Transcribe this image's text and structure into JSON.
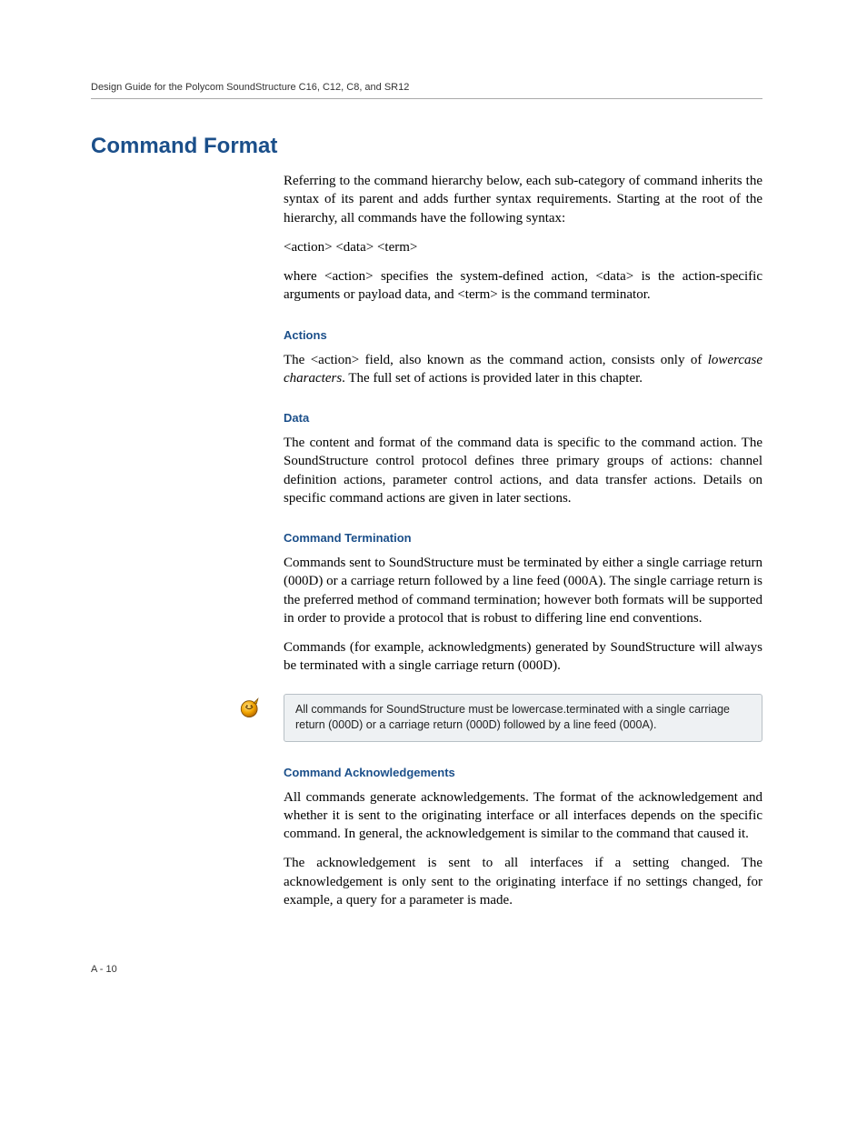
{
  "header": {
    "runningTitle": "Design Guide for the Polycom SoundStructure C16, C12, C8, and SR12"
  },
  "title": "Command Format",
  "intro": {
    "p1": "Referring to the command hierarchy below, each sub-category of command inherits the syntax of its parent and adds further syntax requirements. Starting at the root of the hierarchy, all commands have the following syntax:",
    "syntax": "<action> <data> <term>",
    "p2": "where <action> specifies the system-defined action, <data> is the action-specific arguments or payload data, and <term> is the command terminator."
  },
  "sections": {
    "actions": {
      "heading": "Actions",
      "p1a": "The <action> field, also known as the command action, consists only of ",
      "p1em": "lowercase characters",
      "p1b": ". The full set of actions is provided later in this chapter."
    },
    "data": {
      "heading": "Data",
      "p1": "The content and format of the command data is specific to the command action.  The SoundStructure control protocol defines three primary groups of actions: channel definition actions, parameter control actions, and data transfer actions.  Details on specific command actions are given in later sections."
    },
    "termination": {
      "heading": "Command Termination",
      "p1": "Commands sent to SoundStructure must be terminated by either a single carriage return (000D) or a carriage return followed by a line feed (000A).  The single carriage return is the preferred method of command termination; however both formats will be supported in order to provide a protocol that is robust to differing line end conventions.",
      "p2": "Commands (for example, acknowledgments) generated by SoundStructure will always be terminated with a single carriage return (000D)."
    },
    "note": "All commands for SoundStructure must be lowercase.terminated with a single carriage return (000D) or a carriage return (000D) followed by a line feed (000A).",
    "ack": {
      "heading": "Command Acknowledgements",
      "p1": "All commands generate acknowledgements.  The format of the acknowledgement and whether it is sent to the originating interface or all interfaces depends on the specific command.  In general, the acknowledgement is similar to the command that caused it.",
      "p2": "The acknowledgement is sent to all interfaces if a setting changed. The acknowledgement is only sent to the originating interface if no settings changed, for example, a query for a parameter is made."
    }
  },
  "pageNumber": "A - 10"
}
